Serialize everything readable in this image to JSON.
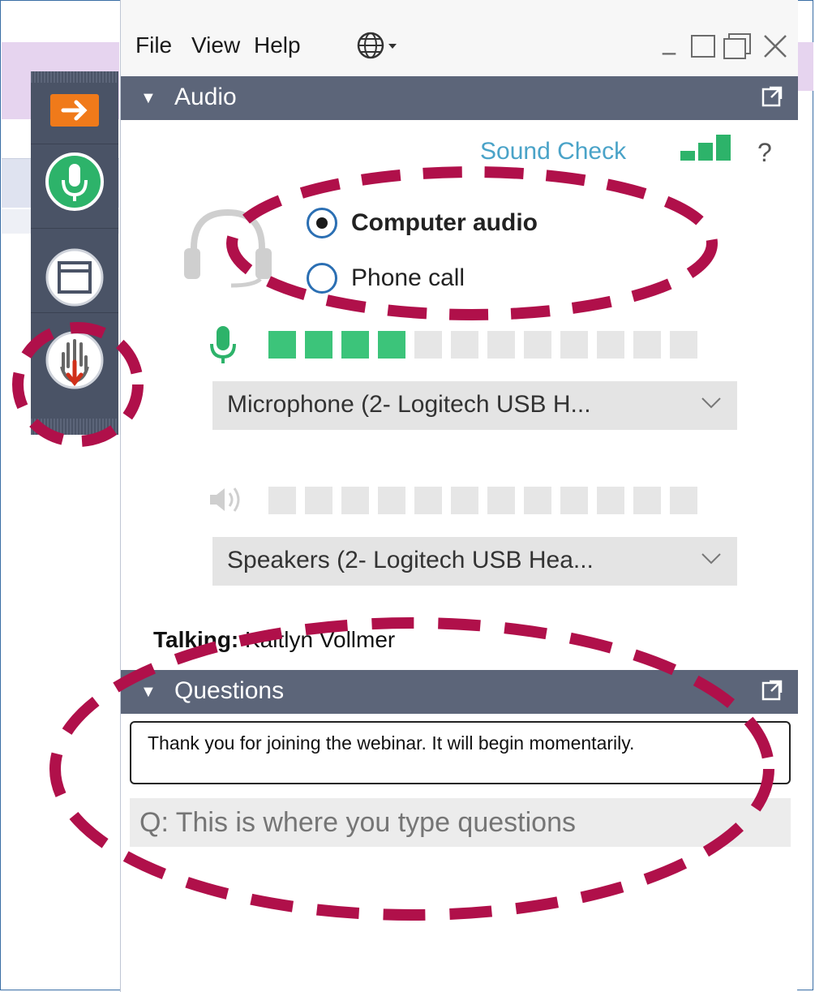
{
  "menu": {
    "file": "File",
    "view": "View",
    "help": "Help"
  },
  "window_controls": {
    "minimize": "_",
    "maximize": "□",
    "restore": "⧉",
    "close": "✕"
  },
  "audio": {
    "title": "Audio",
    "sound_check": "Sound Check",
    "help": "?",
    "computer_audio": "Computer audio",
    "phone_call": "Phone call",
    "selected_mode": "Computer audio",
    "mic_level": 4,
    "speaker_level": 0,
    "meter_segments": 12,
    "microphone": "Microphone (2- Logitech USB H...",
    "speakers": "Speakers (2- Logitech USB Hea...",
    "talking_label": "Talking:",
    "talking_name": "Kaitlyn Vollmer"
  },
  "questions": {
    "title": "Questions",
    "message": "Thank you for joining the webinar. It will begin momentarily.",
    "input_placeholder": "Q: This is where you type questions"
  },
  "colors": {
    "accent_green": "#2db36a",
    "meter_on": "#3cc47a",
    "meter_off": "#e6e6e6",
    "bar": "#5c6579",
    "toolbar": "#4a5366",
    "link": "#4aa3c8",
    "annotation": "#b0104a",
    "orange": "#f07a1a"
  }
}
